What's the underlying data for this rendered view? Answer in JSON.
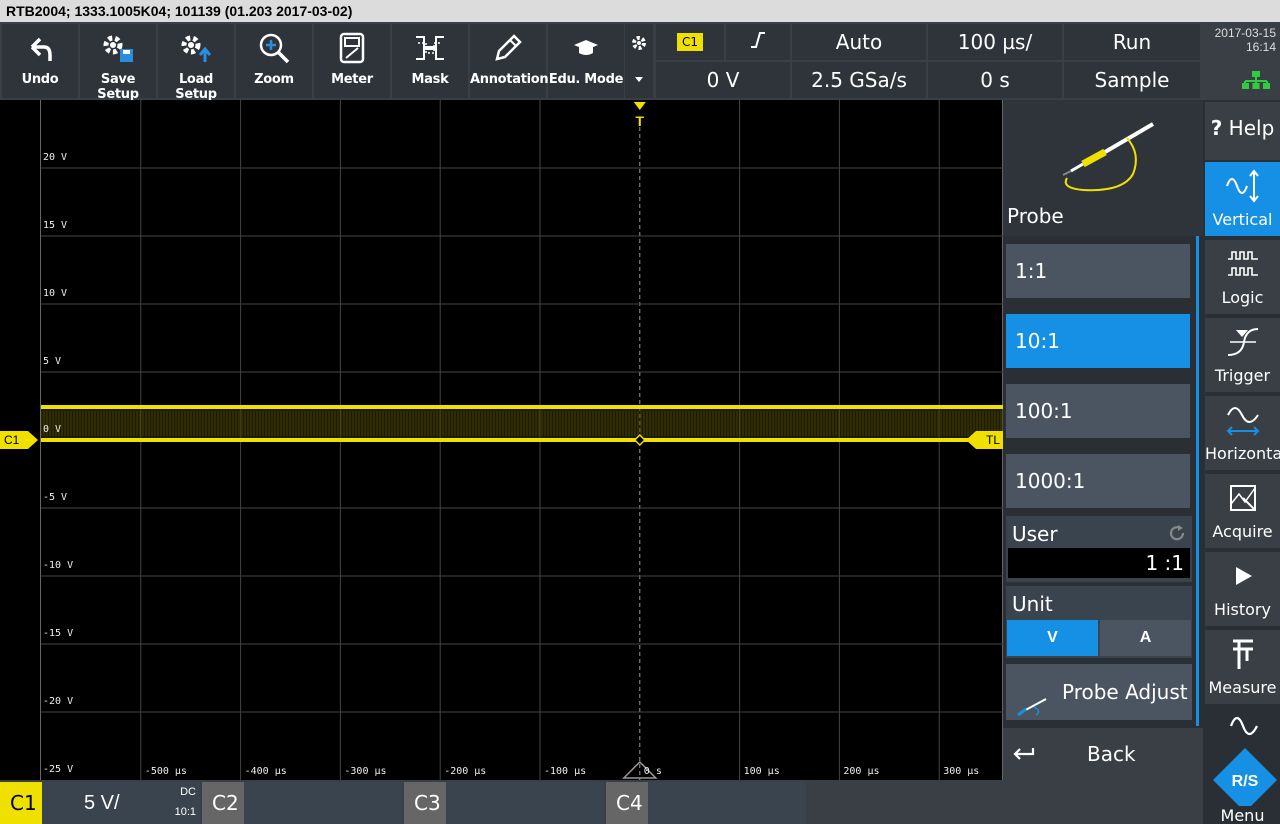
{
  "title": "RTB2004; 1333.1005K04; 101139 (01.203 2017-03-02)",
  "toolbar": {
    "buttons": [
      {
        "label": "Undo",
        "icon": "undo-icon"
      },
      {
        "label": "Save Setup",
        "icon": "save-setup-icon"
      },
      {
        "label": "Load Setup",
        "icon": "load-setup-icon"
      },
      {
        "label": "Zoom",
        "icon": "zoom-icon"
      },
      {
        "label": "Meter",
        "icon": "meter-icon"
      },
      {
        "label": "Mask",
        "icon": "mask-icon"
      },
      {
        "label": "Annotation",
        "icon": "annotation-icon"
      },
      {
        "label": "Edu. Mode",
        "icon": "edu-mode-icon"
      }
    ]
  },
  "status": {
    "trigger_source": "C1",
    "trigger_level": "0 V",
    "trigger_mode": "Auto",
    "sample_rate": "2.5 GSa/s",
    "timebase": "100 µs/",
    "time_offset": "0 s",
    "run_state": "Run",
    "acq_mode": "Sample"
  },
  "datetime": {
    "date": "2017-03-15",
    "time": "16:14"
  },
  "grid": {
    "y_labels": [
      "20 V",
      "15 V",
      "10 V",
      "5 V",
      "0 V",
      "-5 V",
      "-10 V",
      "-15 V",
      "-20 V",
      "-25 V"
    ],
    "x_labels": [
      "-500 µs",
      "-400 µs",
      "-300 µs",
      "-200 µs",
      "-100 µs",
      "0 s",
      "100 µs",
      "200 µs",
      "300 µs"
    ],
    "trigger_top_marker": "T",
    "channel_marker": "C1",
    "trigger_level_marker": "TL",
    "trace_color": "#f0e000"
  },
  "probe_panel": {
    "title": "Probe",
    "options": [
      "1:1",
      "10:1",
      "100:1",
      "1000:1"
    ],
    "selected_index": 1,
    "user_label": "User",
    "user_value": "1 :1",
    "unit_label": "Unit",
    "units": [
      "V",
      "A"
    ],
    "selected_unit": "V",
    "probe_adjust": "Probe Adjust",
    "back": "Back",
    "accent": "#1590e4"
  },
  "right_menu": {
    "help": "Help",
    "items": [
      {
        "label": "Vertical",
        "icon": "vertical-icon"
      },
      {
        "label": "Logic",
        "icon": "logic-icon"
      },
      {
        "label": "Trigger",
        "icon": "trigger-icon"
      },
      {
        "label": "Horizontal",
        "icon": "horizontal-icon"
      },
      {
        "label": "Acquire",
        "icon": "acquire-icon"
      },
      {
        "label": "History",
        "icon": "history-icon"
      },
      {
        "label": "Measure",
        "icon": "measure-icon"
      }
    ],
    "menu": "Menu"
  },
  "channels": {
    "c1": {
      "name": "C1",
      "scale": "5 V/",
      "coupling": "DC",
      "probe": "10:1"
    },
    "c2": {
      "name": "C2"
    },
    "c3": {
      "name": "C3"
    },
    "c4": {
      "name": "C4"
    }
  }
}
